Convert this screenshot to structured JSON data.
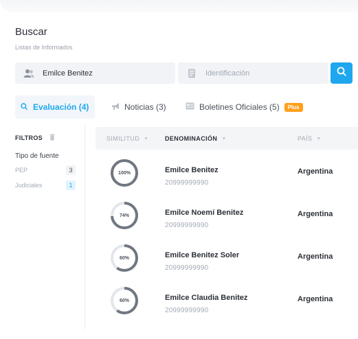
{
  "header": {
    "title": "Buscar",
    "subtitle": "Listas de Informados"
  },
  "search": {
    "name_value": "Emilce Benitez",
    "id_placeholder": "Identificación"
  },
  "tabs": [
    {
      "label": "Evaluación (4)",
      "icon": "search-icon",
      "active": true
    },
    {
      "label": "Noticias (3)",
      "icon": "megaphone-icon",
      "active": false
    },
    {
      "label": "Boletines Oficiales (5)",
      "icon": "newspaper-icon",
      "active": false,
      "badge": "Plus"
    }
  ],
  "filters": {
    "title": "FILTROS",
    "type_label": "Tipo de fuente",
    "items": [
      {
        "label": "PEP",
        "count": "3"
      },
      {
        "label": "Judiciales",
        "count": "1"
      }
    ]
  },
  "table": {
    "columns": [
      "SIMILITUD",
      "DENOMINACIÓN",
      "PAÍS"
    ],
    "rows": [
      {
        "similarity": "100%",
        "similarity_value": 100,
        "name": "Emilce Benitez",
        "id": "20999999990",
        "country": "Argentina"
      },
      {
        "similarity": "74%",
        "similarity_value": 74,
        "name": "Emilce Noemí Benitez",
        "id": "20999999990",
        "country": "Argentina"
      },
      {
        "similarity": "60%",
        "similarity_value": 60,
        "name": "Emilce Benitez Soler",
        "id": "20999999990",
        "country": "Argentina"
      },
      {
        "similarity": "60%",
        "similarity_value": 60,
        "name": "Emilce Claudia Benitez",
        "id": "20999999990",
        "country": "Argentina"
      }
    ]
  },
  "colors": {
    "accent": "#1ea7ee",
    "badge": "#ff9f1a",
    "ring_fill": "#707780",
    "ring_track": "#e3e6ea"
  }
}
